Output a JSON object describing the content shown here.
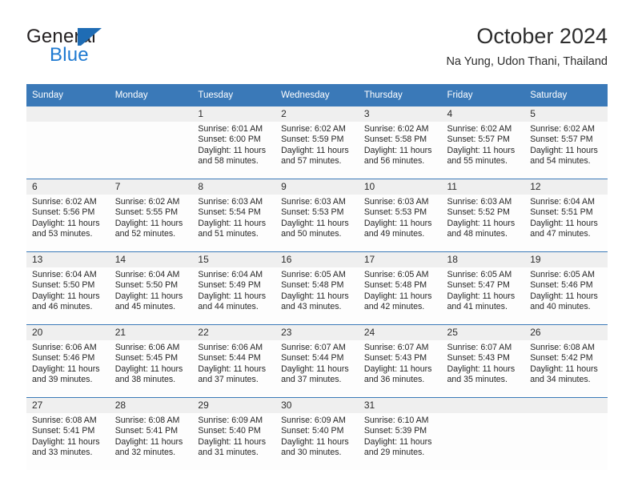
{
  "logo": {
    "text_primary": "General",
    "text_secondary": "Blue",
    "mark_icon": "blue-triangle-flag-icon",
    "accent_color": "#1f7ad1"
  },
  "header": {
    "month_title": "October 2024",
    "location": "Na Yung, Udon Thani, Thailand"
  },
  "theme": {
    "header_blue": "#3a79b8",
    "daynum_band": "#efefef",
    "cell_background": "#fdfdfd",
    "text_color": "#262626"
  },
  "calendar": {
    "weekday_headers": [
      "Sunday",
      "Monday",
      "Tuesday",
      "Wednesday",
      "Thursday",
      "Friday",
      "Saturday"
    ],
    "weeks": [
      [
        {
          "day": "",
          "sunrise": "",
          "sunset": "",
          "daylight_line1": "",
          "daylight_line2": ""
        },
        {
          "day": "",
          "sunrise": "",
          "sunset": "",
          "daylight_line1": "",
          "daylight_line2": ""
        },
        {
          "day": "1",
          "sunrise": "Sunrise: 6:01 AM",
          "sunset": "Sunset: 6:00 PM",
          "daylight_line1": "Daylight: 11 hours",
          "daylight_line2": "and 58 minutes."
        },
        {
          "day": "2",
          "sunrise": "Sunrise: 6:02 AM",
          "sunset": "Sunset: 5:59 PM",
          "daylight_line1": "Daylight: 11 hours",
          "daylight_line2": "and 57 minutes."
        },
        {
          "day": "3",
          "sunrise": "Sunrise: 6:02 AM",
          "sunset": "Sunset: 5:58 PM",
          "daylight_line1": "Daylight: 11 hours",
          "daylight_line2": "and 56 minutes."
        },
        {
          "day": "4",
          "sunrise": "Sunrise: 6:02 AM",
          "sunset": "Sunset: 5:57 PM",
          "daylight_line1": "Daylight: 11 hours",
          "daylight_line2": "and 55 minutes."
        },
        {
          "day": "5",
          "sunrise": "Sunrise: 6:02 AM",
          "sunset": "Sunset: 5:57 PM",
          "daylight_line1": "Daylight: 11 hours",
          "daylight_line2": "and 54 minutes."
        }
      ],
      [
        {
          "day": "6",
          "sunrise": "Sunrise: 6:02 AM",
          "sunset": "Sunset: 5:56 PM",
          "daylight_line1": "Daylight: 11 hours",
          "daylight_line2": "and 53 minutes."
        },
        {
          "day": "7",
          "sunrise": "Sunrise: 6:02 AM",
          "sunset": "Sunset: 5:55 PM",
          "daylight_line1": "Daylight: 11 hours",
          "daylight_line2": "and 52 minutes."
        },
        {
          "day": "8",
          "sunrise": "Sunrise: 6:03 AM",
          "sunset": "Sunset: 5:54 PM",
          "daylight_line1": "Daylight: 11 hours",
          "daylight_line2": "and 51 minutes."
        },
        {
          "day": "9",
          "sunrise": "Sunrise: 6:03 AM",
          "sunset": "Sunset: 5:53 PM",
          "daylight_line1": "Daylight: 11 hours",
          "daylight_line2": "and 50 minutes."
        },
        {
          "day": "10",
          "sunrise": "Sunrise: 6:03 AM",
          "sunset": "Sunset: 5:53 PM",
          "daylight_line1": "Daylight: 11 hours",
          "daylight_line2": "and 49 minutes."
        },
        {
          "day": "11",
          "sunrise": "Sunrise: 6:03 AM",
          "sunset": "Sunset: 5:52 PM",
          "daylight_line1": "Daylight: 11 hours",
          "daylight_line2": "and 48 minutes."
        },
        {
          "day": "12",
          "sunrise": "Sunrise: 6:04 AM",
          "sunset": "Sunset: 5:51 PM",
          "daylight_line1": "Daylight: 11 hours",
          "daylight_line2": "and 47 minutes."
        }
      ],
      [
        {
          "day": "13",
          "sunrise": "Sunrise: 6:04 AM",
          "sunset": "Sunset: 5:50 PM",
          "daylight_line1": "Daylight: 11 hours",
          "daylight_line2": "and 46 minutes."
        },
        {
          "day": "14",
          "sunrise": "Sunrise: 6:04 AM",
          "sunset": "Sunset: 5:50 PM",
          "daylight_line1": "Daylight: 11 hours",
          "daylight_line2": "and 45 minutes."
        },
        {
          "day": "15",
          "sunrise": "Sunrise: 6:04 AM",
          "sunset": "Sunset: 5:49 PM",
          "daylight_line1": "Daylight: 11 hours",
          "daylight_line2": "and 44 minutes."
        },
        {
          "day": "16",
          "sunrise": "Sunrise: 6:05 AM",
          "sunset": "Sunset: 5:48 PM",
          "daylight_line1": "Daylight: 11 hours",
          "daylight_line2": "and 43 minutes."
        },
        {
          "day": "17",
          "sunrise": "Sunrise: 6:05 AM",
          "sunset": "Sunset: 5:48 PM",
          "daylight_line1": "Daylight: 11 hours",
          "daylight_line2": "and 42 minutes."
        },
        {
          "day": "18",
          "sunrise": "Sunrise: 6:05 AM",
          "sunset": "Sunset: 5:47 PM",
          "daylight_line1": "Daylight: 11 hours",
          "daylight_line2": "and 41 minutes."
        },
        {
          "day": "19",
          "sunrise": "Sunrise: 6:05 AM",
          "sunset": "Sunset: 5:46 PM",
          "daylight_line1": "Daylight: 11 hours",
          "daylight_line2": "and 40 minutes."
        }
      ],
      [
        {
          "day": "20",
          "sunrise": "Sunrise: 6:06 AM",
          "sunset": "Sunset: 5:46 PM",
          "daylight_line1": "Daylight: 11 hours",
          "daylight_line2": "and 39 minutes."
        },
        {
          "day": "21",
          "sunrise": "Sunrise: 6:06 AM",
          "sunset": "Sunset: 5:45 PM",
          "daylight_line1": "Daylight: 11 hours",
          "daylight_line2": "and 38 minutes."
        },
        {
          "day": "22",
          "sunrise": "Sunrise: 6:06 AM",
          "sunset": "Sunset: 5:44 PM",
          "daylight_line1": "Daylight: 11 hours",
          "daylight_line2": "and 37 minutes."
        },
        {
          "day": "23",
          "sunrise": "Sunrise: 6:07 AM",
          "sunset": "Sunset: 5:44 PM",
          "daylight_line1": "Daylight: 11 hours",
          "daylight_line2": "and 37 minutes."
        },
        {
          "day": "24",
          "sunrise": "Sunrise: 6:07 AM",
          "sunset": "Sunset: 5:43 PM",
          "daylight_line1": "Daylight: 11 hours",
          "daylight_line2": "and 36 minutes."
        },
        {
          "day": "25",
          "sunrise": "Sunrise: 6:07 AM",
          "sunset": "Sunset: 5:43 PM",
          "daylight_line1": "Daylight: 11 hours",
          "daylight_line2": "and 35 minutes."
        },
        {
          "day": "26",
          "sunrise": "Sunrise: 6:08 AM",
          "sunset": "Sunset: 5:42 PM",
          "daylight_line1": "Daylight: 11 hours",
          "daylight_line2": "and 34 minutes."
        }
      ],
      [
        {
          "day": "27",
          "sunrise": "Sunrise: 6:08 AM",
          "sunset": "Sunset: 5:41 PM",
          "daylight_line1": "Daylight: 11 hours",
          "daylight_line2": "and 33 minutes."
        },
        {
          "day": "28",
          "sunrise": "Sunrise: 6:08 AM",
          "sunset": "Sunset: 5:41 PM",
          "daylight_line1": "Daylight: 11 hours",
          "daylight_line2": "and 32 minutes."
        },
        {
          "day": "29",
          "sunrise": "Sunrise: 6:09 AM",
          "sunset": "Sunset: 5:40 PM",
          "daylight_line1": "Daylight: 11 hours",
          "daylight_line2": "and 31 minutes."
        },
        {
          "day": "30",
          "sunrise": "Sunrise: 6:09 AM",
          "sunset": "Sunset: 5:40 PM",
          "daylight_line1": "Daylight: 11 hours",
          "daylight_line2": "and 30 minutes."
        },
        {
          "day": "31",
          "sunrise": "Sunrise: 6:10 AM",
          "sunset": "Sunset: 5:39 PM",
          "daylight_line1": "Daylight: 11 hours",
          "daylight_line2": "and 29 minutes."
        },
        {
          "day": "",
          "sunrise": "",
          "sunset": "",
          "daylight_line1": "",
          "daylight_line2": ""
        },
        {
          "day": "",
          "sunrise": "",
          "sunset": "",
          "daylight_line1": "",
          "daylight_line2": ""
        }
      ]
    ]
  }
}
